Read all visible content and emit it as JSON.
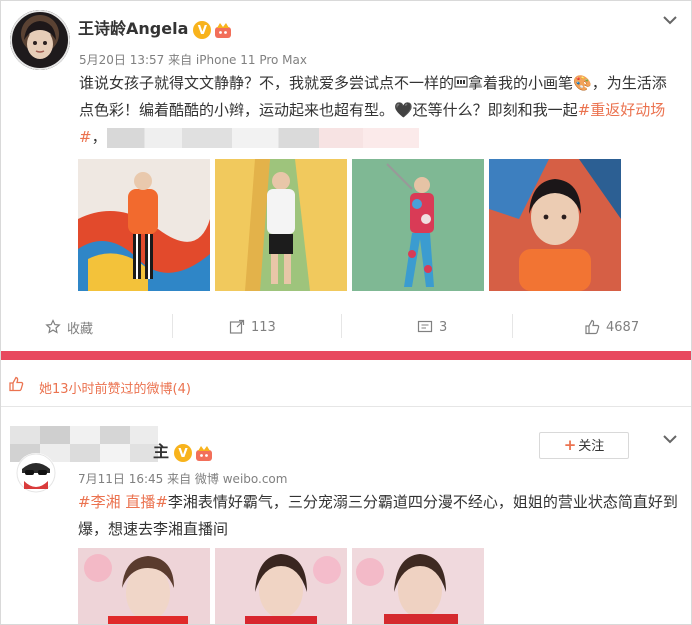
{
  "post1": {
    "username": "王诗龄Angela",
    "verified_badge": "V",
    "meta": "5月20日 13:57 来自 iPhone 11 Pro Max",
    "text_part1": "谁说女孩子就得文文静静？不，我就爱多尝试点不一样的",
    "text_part2": "拿着我的小画笔🎨，为生活添点色彩！编着酷酷的小辫，运动起来也超有型。🖤还等什么？即刻和我一起",
    "topic": "#重返好动场#",
    "text_part3": "，",
    "photos": [
      "painting-girl-photo",
      "yellow-backdrop-photo",
      "golf-swing-photo",
      "orange-jacket-portrait-photo"
    ],
    "actions": {
      "favorite": "收藏",
      "forward": "113",
      "comment": "3",
      "like": "4687"
    }
  },
  "liked_notice": "她13小时前赞过的微博(4)",
  "post2": {
    "username_suffix": "主",
    "verified_badge": "V",
    "follow_label": "关注",
    "meta": "7月11日 16:45 来自 微博 weibo.com",
    "topic": "#李湘 直播#",
    "text": "李湘表情好霸气，三分宠溺三分霸道四分漫不经心，姐姐的营业状态简直好到爆，想速去李湘直播间"
  },
  "colors": {
    "accent": "#eb7350",
    "badge": "#f8b31c",
    "red_bar": "#e8485e"
  }
}
